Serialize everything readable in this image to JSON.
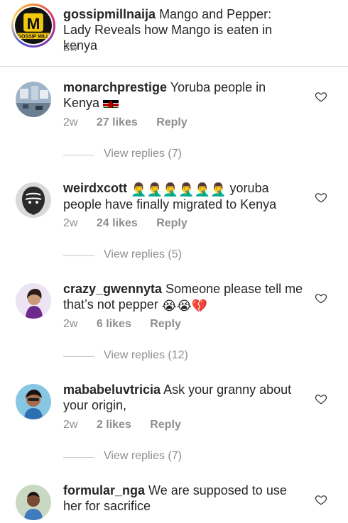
{
  "caption": {
    "username": "gossipmillnaija",
    "text": "Mango and Pepper: Lady Reveals how Mango is eaten in kenya",
    "time": "2w",
    "avatar_letter": "M",
    "avatar_label": "GOSSIP MILL"
  },
  "comments": [
    {
      "username": "monarchprestige",
      "text": "Yoruba people in Kenya",
      "emoji": "kenya-flag",
      "time": "2w",
      "likes": "27 likes",
      "reply": "Reply",
      "view_replies": "View replies (7)"
    },
    {
      "username": "weirdxcott",
      "emoji_text": "🤦‍♂️🤦‍♂️🤦‍♂️🤦‍♂️🤦‍♂️🤦‍♂️",
      "text": "yoruba people have finally migrated to Kenya",
      "time": "2w",
      "likes": "24 likes",
      "reply": "Reply",
      "view_replies": "View replies (5)"
    },
    {
      "username": "crazy_gwennyta",
      "text": "Someone please tell me that’s not pepper",
      "emoji_text": "😭😭💔",
      "time": "2w",
      "likes": "6 likes",
      "reply": "Reply",
      "view_replies": "View replies (12)"
    },
    {
      "username": "mababeluvtricia",
      "text": "Ask your granny about your origin,",
      "time": "2w",
      "likes": "2 likes",
      "reply": "Reply",
      "view_replies": "View replies (7)"
    },
    {
      "username": "formular_nga",
      "text": "We are supposed to use her for sacrifice"
    }
  ],
  "icons": {
    "like": "heart-outline-icon",
    "kenya_flag": "kenya-flag-icon"
  },
  "colors": {
    "text": "#262626",
    "meta": "#8e8e8e",
    "divider": "#dbdbdb",
    "brand_yellow": "#f2c80f"
  }
}
